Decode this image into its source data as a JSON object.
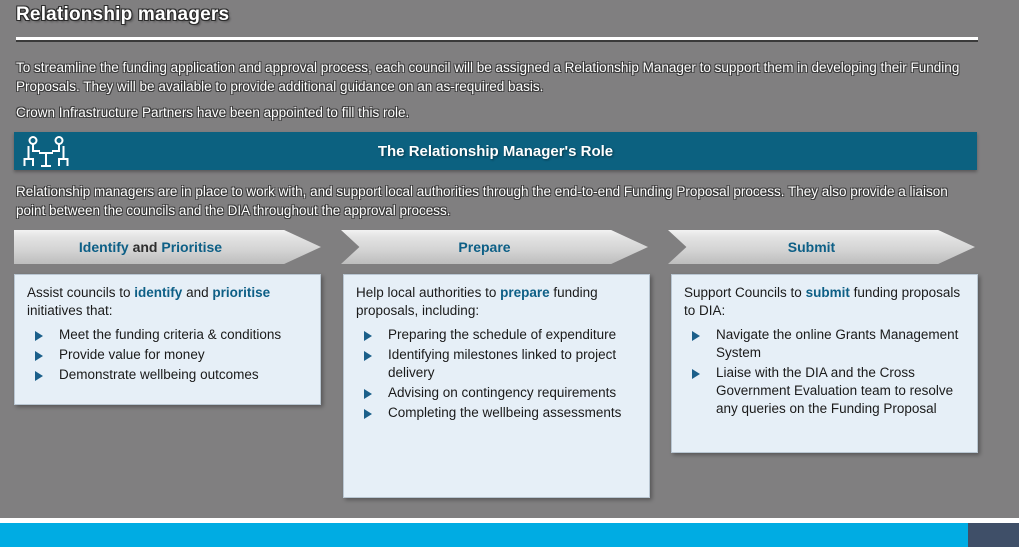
{
  "slide": {
    "title": "Relationship managers",
    "intro_paragraph_1": "To streamline the funding application and approval process, each council will be assigned a Relationship Manager to support them in developing their Funding Proposals.  They will be available to provide additional guidance on an as-required basis.",
    "intro_paragraph_2": "Crown Infrastructure Partners have been appointed to fill this role.",
    "intro_paragraph_3": "Relationship managers are in place to work with, and support local authorities through the end-to-end Funding Proposal process.  They also provide a liaison point between the councils and the DIA throughout the approval process."
  },
  "banner": {
    "icon": "meeting-people-table-icon",
    "title": "The Relationship Manager's Role",
    "background_color": "#0c6180"
  },
  "chevrons": [
    {
      "label_pre": "Identify",
      "label_mid": " and ",
      "label_post": "Prioritise"
    },
    {
      "label_pre": "Prepare",
      "label_mid": "",
      "label_post": ""
    },
    {
      "label_pre": "Submit",
      "label_mid": "",
      "label_post": ""
    }
  ],
  "boxes": [
    {
      "lead_pre": "Assist councils to ",
      "lead_hl1": "identify",
      "lead_mid": " and ",
      "lead_hl2": "prioritise",
      "lead_post": " initiatives that:",
      "bullets": [
        "Meet the funding criteria & conditions",
        "Provide value for money",
        "Demonstrate wellbeing outcomes"
      ]
    },
    {
      "lead_pre": "Help local authorities to ",
      "lead_hl1": "prepare",
      "lead_mid": "",
      "lead_hl2": "",
      "lead_post": " funding proposals, including:",
      "bullets": [
        "Preparing the schedule of expenditure",
        "Identifying milestones linked to project delivery",
        "Advising on contingency requirements",
        "Completing the wellbeing assessments"
      ]
    },
    {
      "lead_pre": "Support Councils to ",
      "lead_hl1": "submit",
      "lead_mid": "",
      "lead_hl2": "",
      "lead_post": " funding proposals to DIA:",
      "bullets": [
        "Navigate the online Grants Management System",
        "Liaise with the DIA and the Cross Government Evaluation team to resolve any queries on the Funding Proposal"
      ]
    }
  ],
  "footer": {
    "bar_color": "#00ace3",
    "accent_color": "#3f4f68"
  }
}
